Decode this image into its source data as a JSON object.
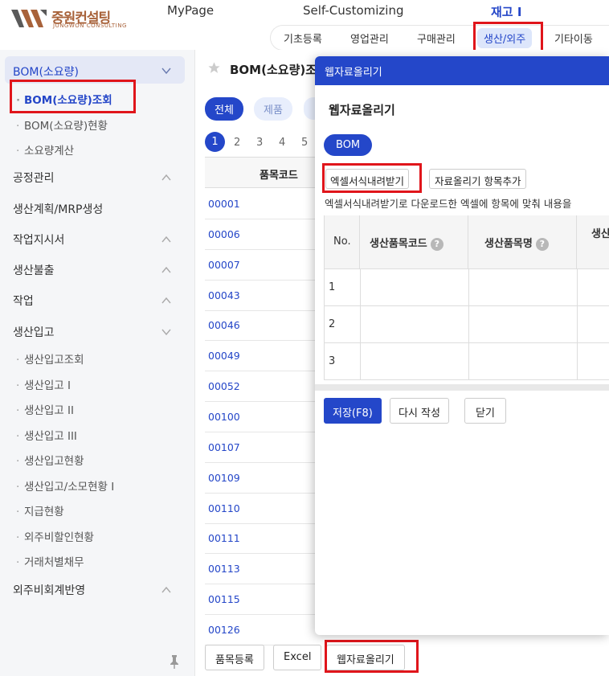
{
  "logo": {
    "ko": "중원컨설팅",
    "en": "JUNGWON CONSULTING"
  },
  "topnav": {
    "mypage": "MyPage",
    "custom": "Self-Customizing",
    "company": "재고 I"
  },
  "tabs": [
    "기초등록",
    "영업관리",
    "구매관리",
    "생산/외주",
    "기타이동"
  ],
  "sidebar": {
    "bom_group": "BOM(소요량)",
    "bom_items": [
      "BOM(소요량)조회",
      "BOM(소요량)현황",
      "소요량계산"
    ],
    "groups_a": [
      "공정관리",
      "생산계획/MRP생성",
      "작업지시서",
      "생산불출",
      "작업"
    ],
    "receipt_group": "생산입고",
    "receipt_items": [
      "생산입고조회",
      "생산입고 I",
      "생산입고 II",
      "생산입고 III",
      "생산입고현황",
      "생산입고/소모현황 I",
      "지급현황",
      "외주비할인현황",
      "거래처별채무"
    ],
    "last_group": "외주비회계반영"
  },
  "main": {
    "title": "BOM(소요량)조",
    "filters": [
      "전체",
      "제품"
    ],
    "pages": [
      "1",
      "2",
      "3",
      "4",
      "5"
    ],
    "col_code": "품목코드",
    "codes": [
      "00001",
      "00006",
      "00007",
      "00043",
      "00046",
      "00049",
      "00052",
      "00100",
      "00107",
      "00109",
      "00110",
      "00111",
      "00113",
      "00115",
      "00126"
    ],
    "buttons": [
      "품목등록",
      "Excel",
      "웹자료올리기"
    ]
  },
  "modal": {
    "bar_title": "웹자료올리기",
    "heading": "웹자료올리기",
    "bom_chip": "BOM",
    "btn_excel": "엑셀서식내려받기",
    "btn_add": "자료올리기 항목추가",
    "hint": "엑셀서식내려받기로 다운로드한 엑셀에 항목에 맞춰 내용을",
    "col_no": "No.",
    "col_code": "생산품목코드",
    "col_name": "생산품목명",
    "col_more": "생산",
    "rows": [
      "1",
      "2",
      "3"
    ],
    "btn_save": "저장(F8)",
    "btn_rewrite": "다시 작성",
    "btn_close": "닫기"
  },
  "colors": {
    "accent": "#2446c8",
    "highlight": "#e0151b",
    "brand": "#a8623a"
  }
}
